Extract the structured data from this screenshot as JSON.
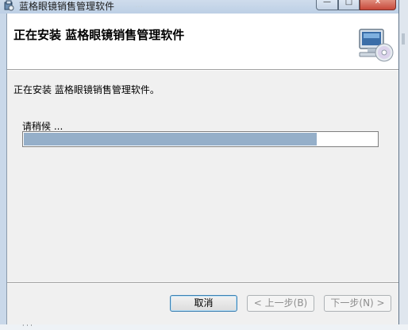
{
  "window": {
    "title": "蓝格眼镜销售管理软件",
    "title_ghost": "…",
    "controls": {
      "minimize": "—",
      "maximize": "□",
      "close": "✕"
    }
  },
  "banner": {
    "heading": "正在安装 蓝格眼镜销售管理软件",
    "icon": "computer-cd-icon"
  },
  "body": {
    "status": "正在安装 蓝格眼镜销售管理软件。",
    "wait_label": "请稍候 ...",
    "progress_percent": 83
  },
  "buttons": {
    "cancel": "取消",
    "prev": "< 上一步(B)",
    "next": "下一步(N) >"
  },
  "colors": {
    "progress_fill": "#95afc9",
    "banner_bg": "#ffffff",
    "client_bg": "#f0f0f0"
  }
}
